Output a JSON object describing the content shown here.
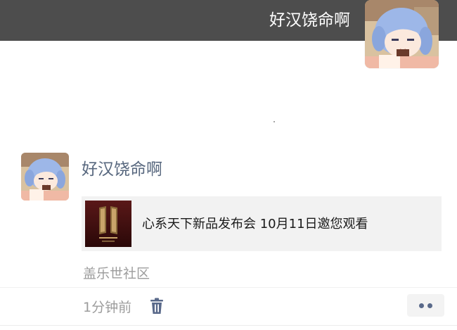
{
  "header": {
    "username": "好汉饶命啊",
    "avatar_icon": "anime-avatar"
  },
  "post": {
    "author": "好汉饶命啊",
    "avatar_icon": "anime-avatar",
    "link_card": {
      "title": "心系天下新品发布会 10月11日邀您观看",
      "thumbnail_icon": "product-launch-thumbnail"
    },
    "source": "盖乐世社区",
    "time": "1分钟前",
    "delete_icon": "trash-icon",
    "more_icon": "more-dots-icon"
  },
  "colors": {
    "header_bg": "#4d4d4d",
    "author_name": "#57677e",
    "meta_text": "#9c9c9c",
    "card_bg": "#f2f2f2",
    "accent_dots": "#59698a"
  }
}
